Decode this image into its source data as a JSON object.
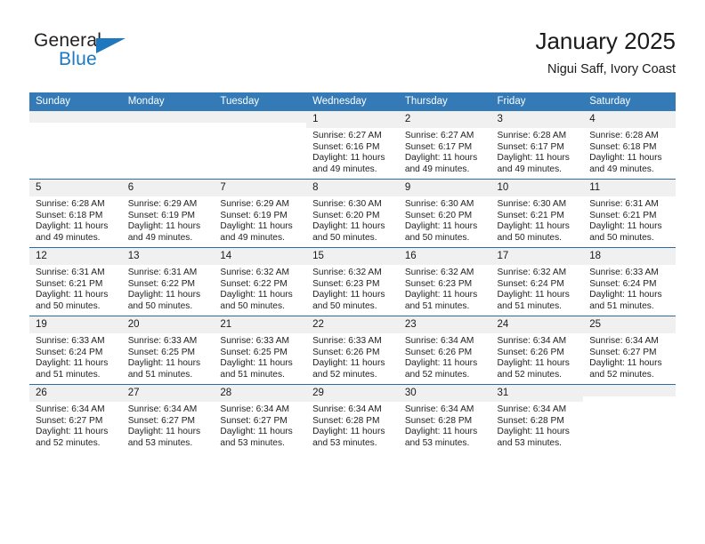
{
  "brand": {
    "name_top": "General",
    "name_bottom": "Blue",
    "accent_color": "#1c7ac0"
  },
  "header": {
    "title": "January 2025",
    "subtitle": "Nigui Saff, Ivory Coast"
  },
  "theme": {
    "header_blue": "#337ab7",
    "row_rule_blue": "#2a6ca5",
    "daynum_bg": "#f0f0f0"
  },
  "calendar": {
    "weekday_headers": [
      "Sunday",
      "Monday",
      "Tuesday",
      "Wednesday",
      "Thursday",
      "Friday",
      "Saturday"
    ],
    "weeks": [
      [
        {
          "day": "",
          "sunrise": "",
          "sunset": "",
          "daylight_1": "",
          "daylight_2": ""
        },
        {
          "day": "",
          "sunrise": "",
          "sunset": "",
          "daylight_1": "",
          "daylight_2": ""
        },
        {
          "day": "",
          "sunrise": "",
          "sunset": "",
          "daylight_1": "",
          "daylight_2": ""
        },
        {
          "day": "1",
          "sunrise": "Sunrise: 6:27 AM",
          "sunset": "Sunset: 6:16 PM",
          "daylight_1": "Daylight: 11 hours",
          "daylight_2": "and 49 minutes."
        },
        {
          "day": "2",
          "sunrise": "Sunrise: 6:27 AM",
          "sunset": "Sunset: 6:17 PM",
          "daylight_1": "Daylight: 11 hours",
          "daylight_2": "and 49 minutes."
        },
        {
          "day": "3",
          "sunrise": "Sunrise: 6:28 AM",
          "sunset": "Sunset: 6:17 PM",
          "daylight_1": "Daylight: 11 hours",
          "daylight_2": "and 49 minutes."
        },
        {
          "day": "4",
          "sunrise": "Sunrise: 6:28 AM",
          "sunset": "Sunset: 6:18 PM",
          "daylight_1": "Daylight: 11 hours",
          "daylight_2": "and 49 minutes."
        }
      ],
      [
        {
          "day": "5",
          "sunrise": "Sunrise: 6:28 AM",
          "sunset": "Sunset: 6:18 PM",
          "daylight_1": "Daylight: 11 hours",
          "daylight_2": "and 49 minutes."
        },
        {
          "day": "6",
          "sunrise": "Sunrise: 6:29 AM",
          "sunset": "Sunset: 6:19 PM",
          "daylight_1": "Daylight: 11 hours",
          "daylight_2": "and 49 minutes."
        },
        {
          "day": "7",
          "sunrise": "Sunrise: 6:29 AM",
          "sunset": "Sunset: 6:19 PM",
          "daylight_1": "Daylight: 11 hours",
          "daylight_2": "and 49 minutes."
        },
        {
          "day": "8",
          "sunrise": "Sunrise: 6:30 AM",
          "sunset": "Sunset: 6:20 PM",
          "daylight_1": "Daylight: 11 hours",
          "daylight_2": "and 50 minutes."
        },
        {
          "day": "9",
          "sunrise": "Sunrise: 6:30 AM",
          "sunset": "Sunset: 6:20 PM",
          "daylight_1": "Daylight: 11 hours",
          "daylight_2": "and 50 minutes."
        },
        {
          "day": "10",
          "sunrise": "Sunrise: 6:30 AM",
          "sunset": "Sunset: 6:21 PM",
          "daylight_1": "Daylight: 11 hours",
          "daylight_2": "and 50 minutes."
        },
        {
          "day": "11",
          "sunrise": "Sunrise: 6:31 AM",
          "sunset": "Sunset: 6:21 PM",
          "daylight_1": "Daylight: 11 hours",
          "daylight_2": "and 50 minutes."
        }
      ],
      [
        {
          "day": "12",
          "sunrise": "Sunrise: 6:31 AM",
          "sunset": "Sunset: 6:21 PM",
          "daylight_1": "Daylight: 11 hours",
          "daylight_2": "and 50 minutes."
        },
        {
          "day": "13",
          "sunrise": "Sunrise: 6:31 AM",
          "sunset": "Sunset: 6:22 PM",
          "daylight_1": "Daylight: 11 hours",
          "daylight_2": "and 50 minutes."
        },
        {
          "day": "14",
          "sunrise": "Sunrise: 6:32 AM",
          "sunset": "Sunset: 6:22 PM",
          "daylight_1": "Daylight: 11 hours",
          "daylight_2": "and 50 minutes."
        },
        {
          "day": "15",
          "sunrise": "Sunrise: 6:32 AM",
          "sunset": "Sunset: 6:23 PM",
          "daylight_1": "Daylight: 11 hours",
          "daylight_2": "and 50 minutes."
        },
        {
          "day": "16",
          "sunrise": "Sunrise: 6:32 AM",
          "sunset": "Sunset: 6:23 PM",
          "daylight_1": "Daylight: 11 hours",
          "daylight_2": "and 51 minutes."
        },
        {
          "day": "17",
          "sunrise": "Sunrise: 6:32 AM",
          "sunset": "Sunset: 6:24 PM",
          "daylight_1": "Daylight: 11 hours",
          "daylight_2": "and 51 minutes."
        },
        {
          "day": "18",
          "sunrise": "Sunrise: 6:33 AM",
          "sunset": "Sunset: 6:24 PM",
          "daylight_1": "Daylight: 11 hours",
          "daylight_2": "and 51 minutes."
        }
      ],
      [
        {
          "day": "19",
          "sunrise": "Sunrise: 6:33 AM",
          "sunset": "Sunset: 6:24 PM",
          "daylight_1": "Daylight: 11 hours",
          "daylight_2": "and 51 minutes."
        },
        {
          "day": "20",
          "sunrise": "Sunrise: 6:33 AM",
          "sunset": "Sunset: 6:25 PM",
          "daylight_1": "Daylight: 11 hours",
          "daylight_2": "and 51 minutes."
        },
        {
          "day": "21",
          "sunrise": "Sunrise: 6:33 AM",
          "sunset": "Sunset: 6:25 PM",
          "daylight_1": "Daylight: 11 hours",
          "daylight_2": "and 51 minutes."
        },
        {
          "day": "22",
          "sunrise": "Sunrise: 6:33 AM",
          "sunset": "Sunset: 6:26 PM",
          "daylight_1": "Daylight: 11 hours",
          "daylight_2": "and 52 minutes."
        },
        {
          "day": "23",
          "sunrise": "Sunrise: 6:34 AM",
          "sunset": "Sunset: 6:26 PM",
          "daylight_1": "Daylight: 11 hours",
          "daylight_2": "and 52 minutes."
        },
        {
          "day": "24",
          "sunrise": "Sunrise: 6:34 AM",
          "sunset": "Sunset: 6:26 PM",
          "daylight_1": "Daylight: 11 hours",
          "daylight_2": "and 52 minutes."
        },
        {
          "day": "25",
          "sunrise": "Sunrise: 6:34 AM",
          "sunset": "Sunset: 6:27 PM",
          "daylight_1": "Daylight: 11 hours",
          "daylight_2": "and 52 minutes."
        }
      ],
      [
        {
          "day": "26",
          "sunrise": "Sunrise: 6:34 AM",
          "sunset": "Sunset: 6:27 PM",
          "daylight_1": "Daylight: 11 hours",
          "daylight_2": "and 52 minutes."
        },
        {
          "day": "27",
          "sunrise": "Sunrise: 6:34 AM",
          "sunset": "Sunset: 6:27 PM",
          "daylight_1": "Daylight: 11 hours",
          "daylight_2": "and 53 minutes."
        },
        {
          "day": "28",
          "sunrise": "Sunrise: 6:34 AM",
          "sunset": "Sunset: 6:27 PM",
          "daylight_1": "Daylight: 11 hours",
          "daylight_2": "and 53 minutes."
        },
        {
          "day": "29",
          "sunrise": "Sunrise: 6:34 AM",
          "sunset": "Sunset: 6:28 PM",
          "daylight_1": "Daylight: 11 hours",
          "daylight_2": "and 53 minutes."
        },
        {
          "day": "30",
          "sunrise": "Sunrise: 6:34 AM",
          "sunset": "Sunset: 6:28 PM",
          "daylight_1": "Daylight: 11 hours",
          "daylight_2": "and 53 minutes."
        },
        {
          "day": "31",
          "sunrise": "Sunrise: 6:34 AM",
          "sunset": "Sunset: 6:28 PM",
          "daylight_1": "Daylight: 11 hours",
          "daylight_2": "and 53 minutes."
        },
        {
          "day": "",
          "sunrise": "",
          "sunset": "",
          "daylight_1": "",
          "daylight_2": ""
        }
      ]
    ]
  }
}
